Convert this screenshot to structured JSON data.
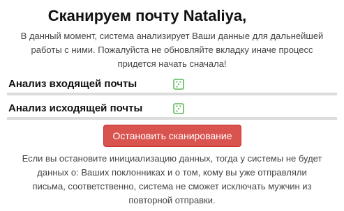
{
  "header": {
    "title": "Сканируем почту Nataliya,"
  },
  "intro": {
    "lines": [
      "В данный момент, система анализирует Ваши данные для дальнейшей",
      "работы с ними. Пожалуйста не обновляйте вкладку иначе процесс",
      "придется начать сначала!"
    ]
  },
  "analysis": {
    "incoming": {
      "label": "Анализ входящей почты",
      "icon": "loading-square-icon",
      "progress": 0
    },
    "outgoing": {
      "label": "Анализ исходящей почты",
      "icon": "loading-square-icon",
      "progress": 0
    }
  },
  "actions": {
    "stop_label": "Остановить сканирование"
  },
  "warning": {
    "lines": [
      "Если вы остановите инициализацию данных, тогда у системы не будет",
      "данных о: Ваших поклонниках и о том, кому вы уже отправляли",
      "письма, соответственно, система не сможет исключать мужчин из",
      "повторной отправки."
    ]
  },
  "colors": {
    "accent_green": "#5cb85c",
    "danger_red": "#d9534f",
    "track_gray": "#dcdcdc"
  }
}
